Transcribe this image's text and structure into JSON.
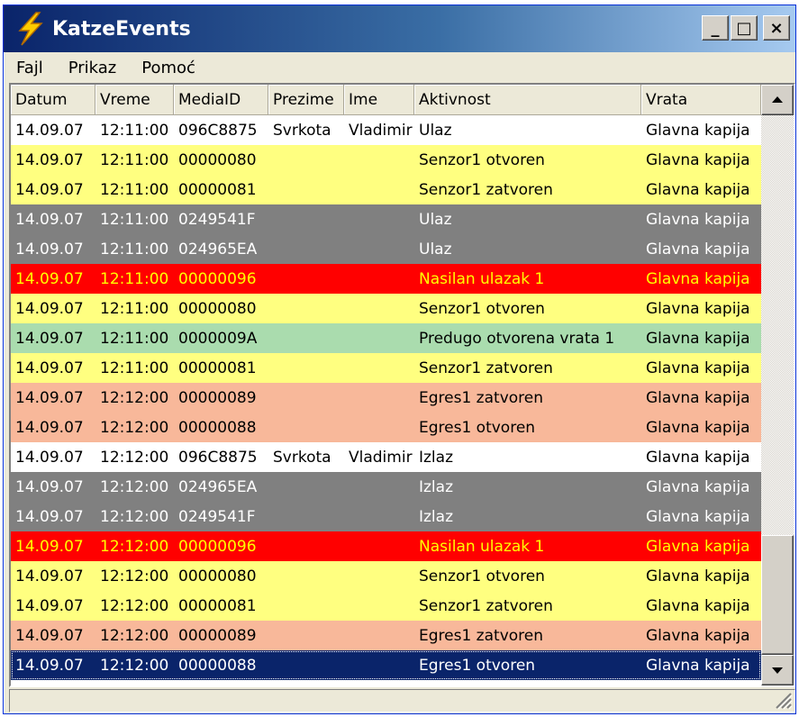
{
  "window": {
    "title": "KatzeEvents",
    "icon": "lightning-bolt-icon"
  },
  "title_buttons": {
    "minimize": "_",
    "maximize": "□",
    "close": "×"
  },
  "menu": [
    "Fajl",
    "Prikaz",
    "Pomoć"
  ],
  "columns": [
    "Datum",
    "Vreme",
    "MediaID",
    "Prezime",
    "Ime",
    "Aktivnost",
    "Vrata"
  ],
  "colors": {
    "white": "#ffffff",
    "yellow": "#ffff80",
    "gray": "#808080",
    "red": "#ff0000",
    "green": "#aadcae",
    "salmon": "#f8b89a",
    "selected": "#0a246a"
  },
  "rows": [
    {
      "color": "white",
      "cells": [
        "14.09.07",
        "12:11:00",
        "096C8875",
        "Svrkota",
        "Vladimir",
        "Ulaz",
        "Glavna kapija"
      ]
    },
    {
      "color": "yellow",
      "cells": [
        "14.09.07",
        "12:11:00",
        "00000080",
        "",
        "",
        "Senzor1 otvoren",
        "Glavna kapija"
      ]
    },
    {
      "color": "yellow",
      "cells": [
        "14.09.07",
        "12:11:00",
        "00000081",
        "",
        "",
        "Senzor1 zatvoren",
        "Glavna kapija"
      ]
    },
    {
      "color": "gray",
      "cells": [
        "14.09.07",
        "12:11:00",
        "0249541F",
        "",
        "",
        "Ulaz",
        "Glavna kapija"
      ]
    },
    {
      "color": "gray",
      "cells": [
        "14.09.07",
        "12:11:00",
        "024965EA",
        "",
        "",
        "Ulaz",
        "Glavna kapija"
      ]
    },
    {
      "color": "red",
      "cells": [
        "14.09.07",
        "12:11:00",
        "00000096",
        "",
        "",
        "Nasilan ulazak 1",
        "Glavna kapija"
      ]
    },
    {
      "color": "yellow",
      "cells": [
        "14.09.07",
        "12:11:00",
        "00000080",
        "",
        "",
        "Senzor1 otvoren",
        "Glavna kapija"
      ]
    },
    {
      "color": "green",
      "cells": [
        "14.09.07",
        "12:11:00",
        "0000009A",
        "",
        "",
        "Predugo otvorena vrata 1",
        "Glavna kapija"
      ]
    },
    {
      "color": "yellow",
      "cells": [
        "14.09.07",
        "12:11:00",
        "00000081",
        "",
        "",
        "Senzor1 zatvoren",
        "Glavna kapija"
      ]
    },
    {
      "color": "salmon",
      "cells": [
        "14.09.07",
        "12:12:00",
        "00000089",
        "",
        "",
        "Egres1 zatvoren",
        "Glavna kapija"
      ]
    },
    {
      "color": "salmon",
      "cells": [
        "14.09.07",
        "12:12:00",
        "00000088",
        "",
        "",
        "Egres1 otvoren",
        "Glavna kapija"
      ]
    },
    {
      "color": "white",
      "cells": [
        "14.09.07",
        "12:12:00",
        "096C8875",
        "Svrkota",
        "Vladimir",
        "Izlaz",
        "Glavna kapija"
      ]
    },
    {
      "color": "gray",
      "cells": [
        "14.09.07",
        "12:12:00",
        "024965EA",
        "",
        "",
        "Izlaz",
        "Glavna kapija"
      ]
    },
    {
      "color": "gray",
      "cells": [
        "14.09.07",
        "12:12:00",
        "0249541F",
        "",
        "",
        "Izlaz",
        "Glavna kapija"
      ]
    },
    {
      "color": "red",
      "cells": [
        "14.09.07",
        "12:12:00",
        "00000096",
        "",
        "",
        "Nasilan ulazak 1",
        "Glavna kapija"
      ]
    },
    {
      "color": "yellow",
      "cells": [
        "14.09.07",
        "12:12:00",
        "00000080",
        "",
        "",
        "Senzor1 otvoren",
        "Glavna kapija"
      ]
    },
    {
      "color": "yellow",
      "cells": [
        "14.09.07",
        "12:12:00",
        "00000081",
        "",
        "",
        "Senzor1 zatvoren",
        "Glavna kapija"
      ]
    },
    {
      "color": "salmon",
      "cells": [
        "14.09.07",
        "12:12:00",
        "00000089",
        "",
        "",
        "Egres1 zatvoren",
        "Glavna kapija"
      ]
    },
    {
      "color": "selected",
      "cells": [
        "14.09.07",
        "12:12:00",
        "00000088",
        "",
        "",
        "Egres1 otvoren",
        "Glavna kapija"
      ]
    }
  ],
  "scrollbar": {
    "up_icon": "arrow-up-icon",
    "down_icon": "arrow-down-icon"
  },
  "statusbar": {
    "text": "",
    "grip_icon": "resize-grip-icon"
  }
}
